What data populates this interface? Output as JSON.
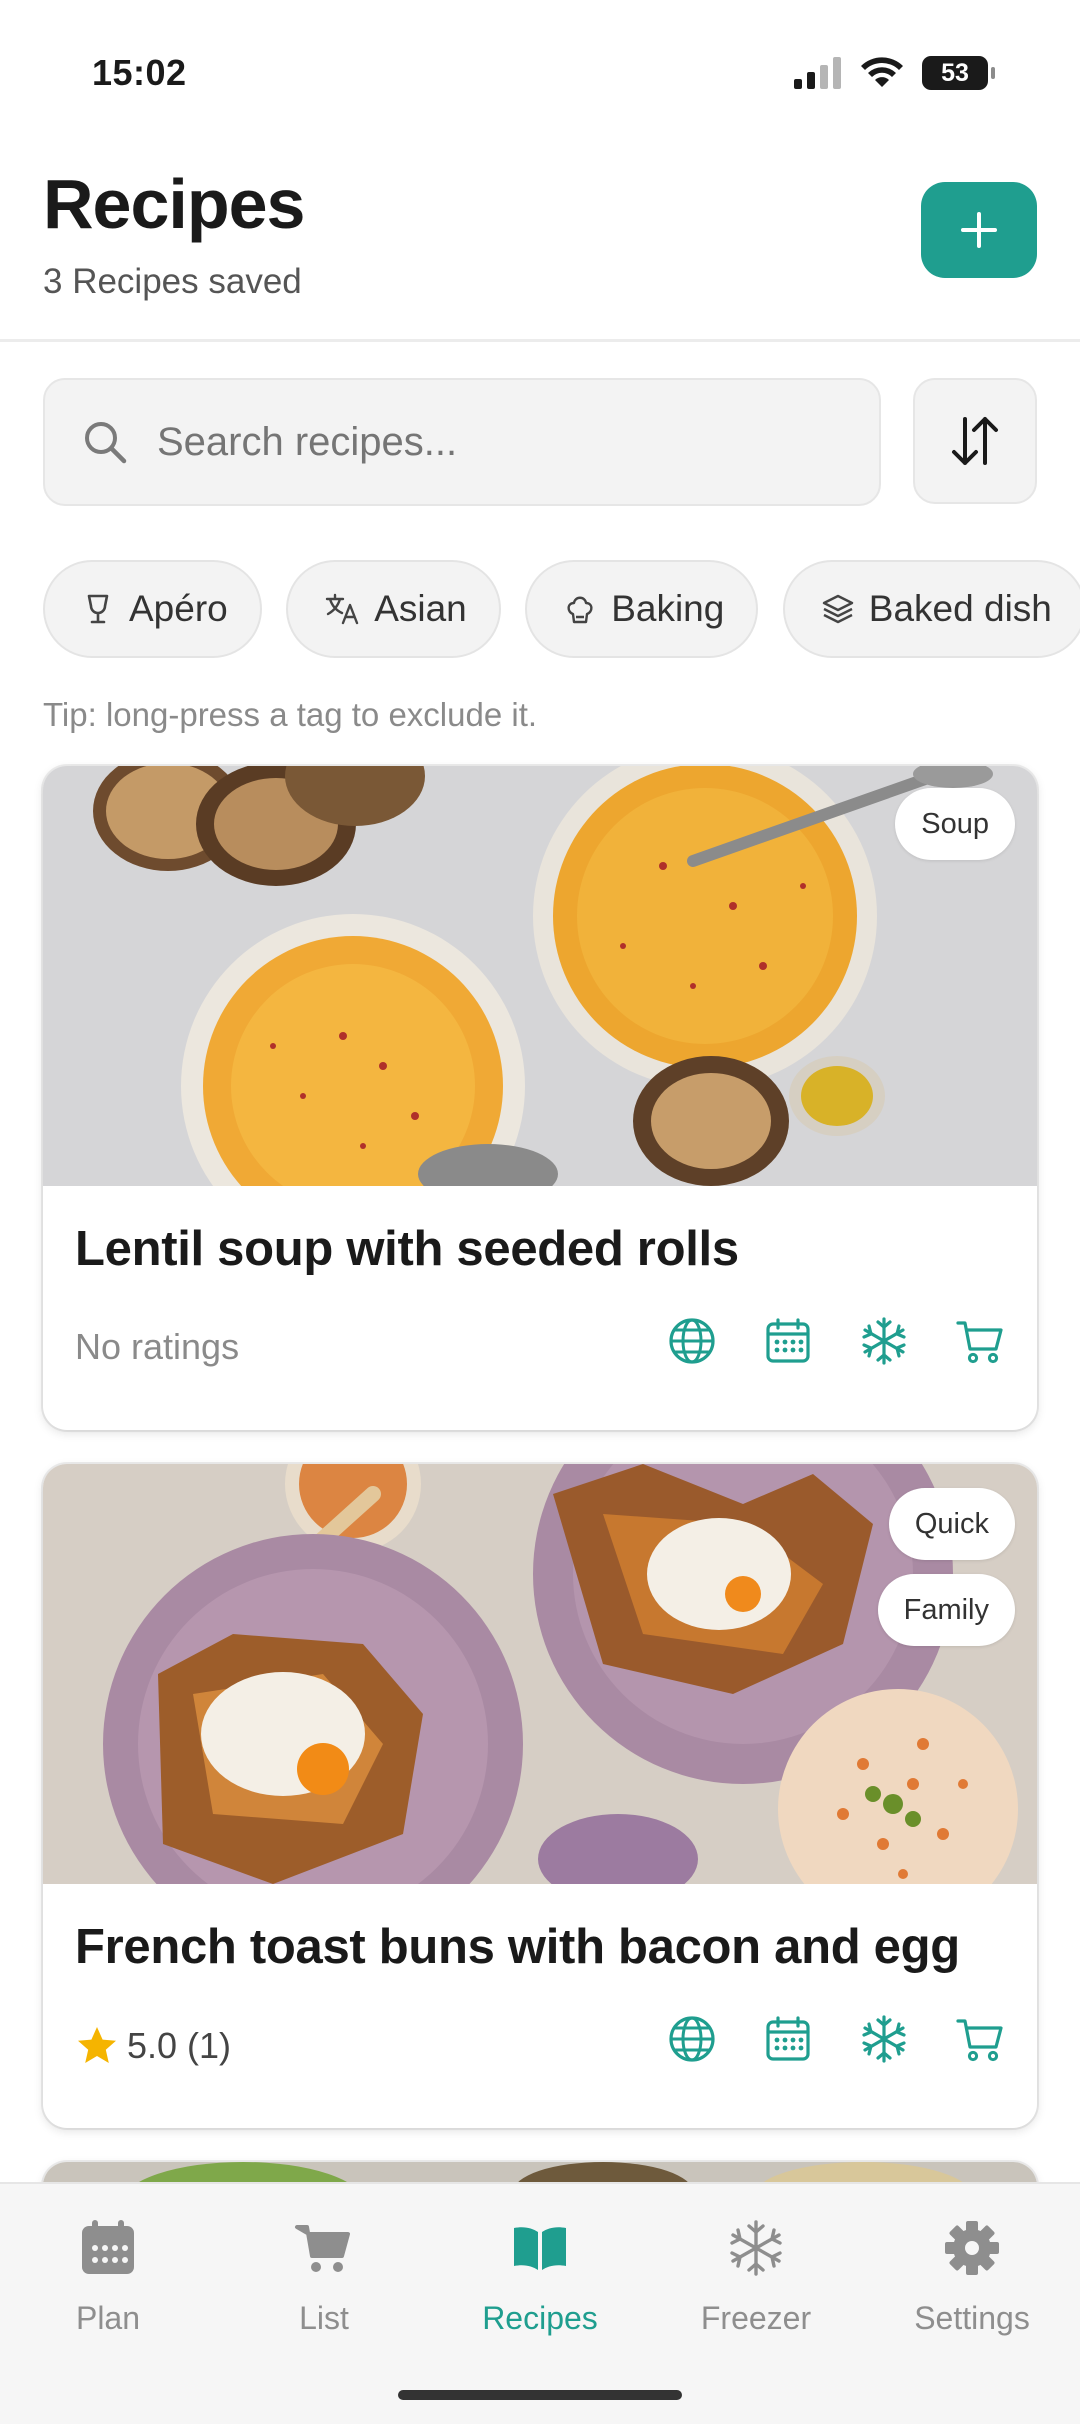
{
  "status": {
    "time": "15:02",
    "battery": "53"
  },
  "header": {
    "title": "Recipes",
    "subtitle": "3 Recipes saved"
  },
  "search": {
    "placeholder": "Search recipes..."
  },
  "tags": [
    "Apéro",
    "Asian",
    "Baking",
    "Baked dish"
  ],
  "tip": "Tip: long-press a tag to exclude it.",
  "recipes": [
    {
      "title": "Lentil soup with seeded rolls",
      "rating": "No ratings",
      "tags": [
        "Soup"
      ]
    },
    {
      "title": "French toast buns with bacon and egg",
      "rating": "5.0 (1)",
      "stars": 1,
      "tags": [
        "Quick",
        "Family"
      ]
    }
  ],
  "nav": [
    {
      "label": "Plan",
      "icon": "calendar-icon"
    },
    {
      "label": "List",
      "icon": "cart-icon"
    },
    {
      "label": "Recipes",
      "icon": "book-icon",
      "active": true
    },
    {
      "label": "Freezer",
      "icon": "snowflake-icon"
    },
    {
      "label": "Settings",
      "icon": "gear-icon"
    }
  ],
  "colors": {
    "accent": "#1f9e8f",
    "star": "#f5b400"
  }
}
